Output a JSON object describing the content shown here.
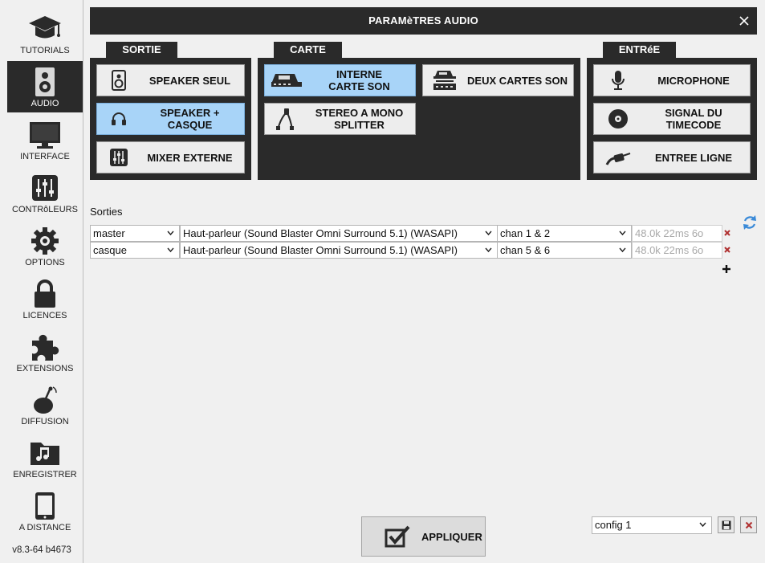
{
  "window": {
    "title": "PARAMèTRES AUDIO"
  },
  "sidebar": {
    "items": [
      {
        "label": "TUTORIALS",
        "icon": "graduation-cap-icon",
        "active": false
      },
      {
        "label": "AUDIO",
        "icon": "speaker-icon",
        "active": true
      },
      {
        "label": "INTERFACE",
        "icon": "monitor-icon",
        "active": false
      },
      {
        "label": "CONTRôLEURS",
        "icon": "sliders-icon",
        "active": false
      },
      {
        "label": "OPTIONS",
        "icon": "gear-icon",
        "active": false
      },
      {
        "label": "LICENCES",
        "icon": "lock-icon",
        "active": false
      },
      {
        "label": "EXTENSIONS",
        "icon": "puzzle-icon",
        "active": false
      },
      {
        "label": "DIFFUSION",
        "icon": "broadcast-icon",
        "active": false
      },
      {
        "label": "ENREGISTRER",
        "icon": "music-folder-icon",
        "active": false
      },
      {
        "label": "A DISTANCE",
        "icon": "tablet-icon",
        "active": false
      }
    ],
    "version": "v8.3-64 b4673"
  },
  "sortie": {
    "tab_label": "SORTIE",
    "options": [
      {
        "label": "SPEAKER SEUL",
        "icon": "speaker-icon",
        "selected": false
      },
      {
        "label": "SPEAKER +\nCASQUE",
        "icon": "headphones-icon",
        "selected": true
      },
      {
        "label": "MIXER EXTERNE",
        "icon": "mixer-icon",
        "selected": false
      }
    ]
  },
  "carte": {
    "tab_label": "CARTE",
    "options": [
      {
        "label": "INTERNE\nCARTE SON",
        "icon": "soundcard-icon",
        "selected": true
      },
      {
        "label": "DEUX CARTES SON",
        "icon": "two-soundcards-icon",
        "selected": false
      },
      {
        "label": "STEREO A MONO\nSPLITTER",
        "icon": "splitter-cable-icon",
        "selected": false
      }
    ]
  },
  "entree": {
    "tab_label": "ENTRéE",
    "options": [
      {
        "label": "MICROPHONE",
        "icon": "microphone-icon",
        "selected": false
      },
      {
        "label": "SIGNAL DU\nTIMECODE",
        "icon": "vinyl-icon",
        "selected": false
      },
      {
        "label": "ENTREE LIGNE",
        "icon": "jack-cable-icon",
        "selected": false
      }
    ]
  },
  "outputs": {
    "label": "Sorties",
    "rows": [
      {
        "name": "master",
        "device": "Haut-parleur (Sound Blaster Omni Surround 5.1) (WASAPI)",
        "channels": "chan 1 & 2",
        "latency": "48.0k 22ms 6o"
      },
      {
        "name": "casque",
        "device": "Haut-parleur (Sound Blaster Omni Surround 5.1) (WASAPI)",
        "channels": "chan 5 & 6",
        "latency": "48.0k 22ms 6o"
      }
    ]
  },
  "footer": {
    "apply_label": "APPLIQUER",
    "config_value": "config 1"
  },
  "colors": {
    "panel_dark": "#2a2a2a",
    "selected_blue": "#a8d4f8",
    "delete_red": "#b03030",
    "refresh_blue": "#3a8ad8"
  }
}
